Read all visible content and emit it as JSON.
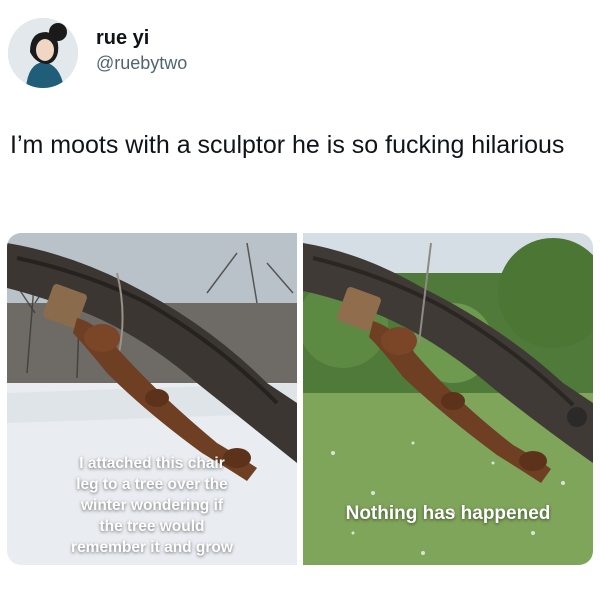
{
  "user": {
    "display_name": "rue yi",
    "handle": "@ruebytwo"
  },
  "tweet": {
    "text": "I’m moots with a sculptor he is so fucking hilarious"
  },
  "media": {
    "left_caption": "I attached this chair\nleg to a tree over the\nwinter wondering if\nthe tree would\nremember it and grow",
    "right_caption": "Nothing has happened"
  }
}
